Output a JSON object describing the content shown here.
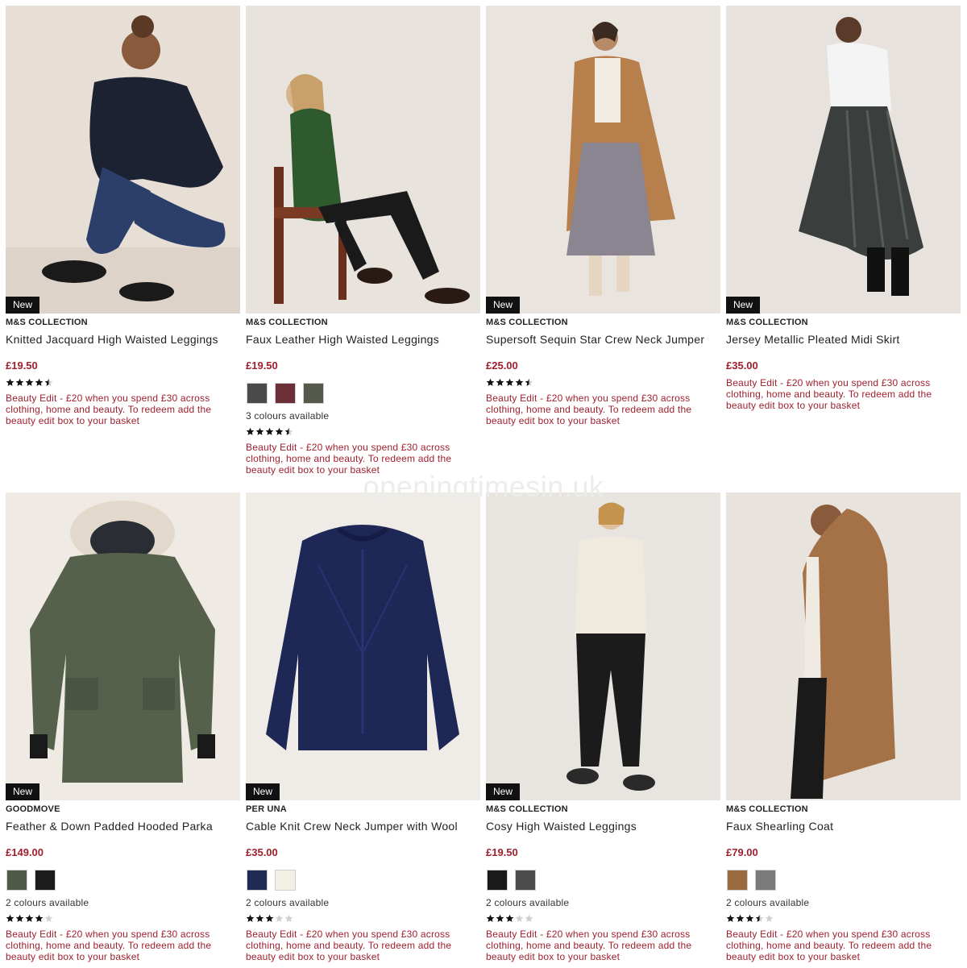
{
  "watermark": "openingtimesin.uk",
  "colors": {
    "price": "#a01f2d",
    "promo": "#a01f2d",
    "badge_bg": "#111111"
  },
  "products": [
    {
      "badge": "New",
      "brand": "M&S COLLECTION",
      "title": "Knitted Jacquard High Waisted Leggings",
      "price": "£19.50",
      "swatches": [],
      "colours_text": "",
      "rating": 4.5,
      "promo": "Beauty Edit - £20 when you spend £30 across clothing, home and beauty. To redeem add the beauty edit box to your basket"
    },
    {
      "badge": "",
      "brand": "M&S COLLECTION",
      "title": "Faux Leather High Waisted Leggings",
      "price": "£19.50",
      "swatches": [
        "#4a4a4a",
        "#6b2f38",
        "#55594c"
      ],
      "colours_text": "3 colours available",
      "rating": 4.5,
      "promo": "Beauty Edit - £20 when you spend £30 across clothing, home and beauty. To redeem add the beauty edit box to your basket"
    },
    {
      "badge": "New",
      "brand": "M&S COLLECTION",
      "title": "Supersoft Sequin Star Crew Neck Jumper",
      "price": "£25.00",
      "swatches": [],
      "colours_text": "",
      "rating": 4.5,
      "promo": "Beauty Edit - £20 when you spend £30 across clothing, home and beauty. To redeem add the beauty edit box to your basket"
    },
    {
      "badge": "New",
      "brand": "M&S COLLECTION",
      "title": "Jersey Metallic Pleated Midi Skirt",
      "price": "£35.00",
      "swatches": [],
      "colours_text": "",
      "rating": 0,
      "promo": "Beauty Edit - £20 when you spend £30 across clothing, home and beauty. To redeem add the beauty edit box to your basket"
    },
    {
      "badge": "New",
      "brand": "GOODMOVE",
      "title": "Feather & Down Padded Hooded Parka",
      "price": "£149.00",
      "swatches": [
        "#4e5a45",
        "#1c1c1c"
      ],
      "colours_text": "2 colours available",
      "rating": 4,
      "promo": "Beauty Edit - £20 when you spend £30 across clothing, home and beauty. To redeem add the beauty edit box to your basket"
    },
    {
      "badge": "New",
      "brand": "PER UNA",
      "title": "Cable Knit Crew Neck Jumper with Wool",
      "price": "£35.00",
      "swatches": [
        "#1f2a55",
        "#f2efe3"
      ],
      "colours_text": "2 colours available",
      "rating": 3,
      "promo": "Beauty Edit - £20 when you spend £30 across clothing, home and beauty. To redeem add the beauty edit box to your basket"
    },
    {
      "badge": "New",
      "brand": "M&S COLLECTION",
      "title": "Cosy High Waisted Leggings",
      "price": "£19.50",
      "swatches": [
        "#1a1a1a",
        "#4b4b4b"
      ],
      "colours_text": "2 colours available",
      "rating": 3,
      "promo": "Beauty Edit - £20 when you spend £30 across clothing, home and beauty. To redeem add the beauty edit box to your basket"
    },
    {
      "badge": "",
      "brand": "M&S COLLECTION",
      "title": "Faux Shearling Coat",
      "price": "£79.00",
      "swatches": [
        "#9a6a3e",
        "#7a7a7a"
      ],
      "colours_text": "2 colours available",
      "rating": 3.5,
      "promo": "Beauty Edit - £20 when you spend £30 across clothing, home and beauty. To redeem add the beauty edit box to your basket"
    }
  ]
}
